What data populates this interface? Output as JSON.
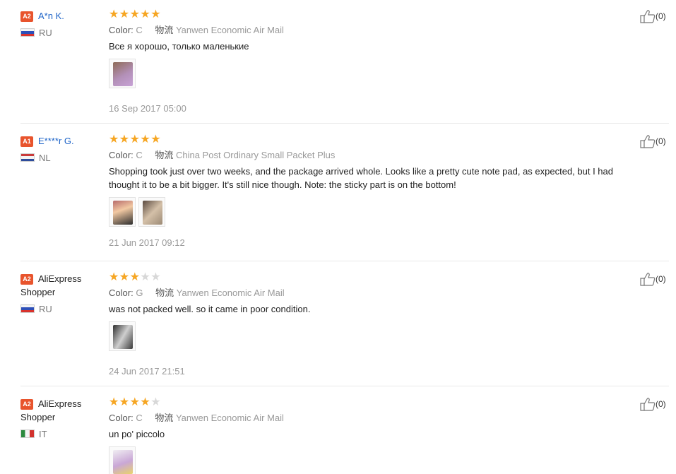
{
  "reviews": [
    {
      "badge": "A2",
      "user": "A*n K.",
      "user_is_link": true,
      "country": "RU",
      "flag": "ru",
      "rating": 5,
      "color_label": "Color:",
      "color_value": "C",
      "logistics_label": "物流",
      "logistics_value": "Yanwen Economic Air Mail",
      "text": "Все я хорошо, только маленькие",
      "photo_count": 1,
      "date": "16 Sep 2017 05:00",
      "helpful": "(0)"
    },
    {
      "badge": "A1",
      "user": "E****r G.",
      "user_is_link": true,
      "country": "NL",
      "flag": "nl",
      "rating": 5,
      "color_label": "Color:",
      "color_value": "C",
      "logistics_label": "物流",
      "logistics_value": "China Post Ordinary Small Packet Plus",
      "text": "Shopping took just over two weeks, and the package arrived whole. Looks like a pretty cute note pad, as expected, but I had thought it to be a bit bigger. It's still nice though. Note: the sticky part is on the bottom!",
      "photo_count": 2,
      "date": "21 Jun 2017 09:12",
      "helpful": "(0)"
    },
    {
      "badge": "A2",
      "user": "AliExpress Shopper",
      "user_is_link": false,
      "country": "RU",
      "flag": "ru",
      "rating": 3,
      "color_label": "Color:",
      "color_value": "G",
      "logistics_label": "物流",
      "logistics_value": "Yanwen Economic Air Mail",
      "text": "was not packed well. so it came in poor condition.",
      "photo_count": 1,
      "date": "24 Jun 2017 21:51",
      "helpful": "(0)"
    },
    {
      "badge": "A2",
      "user": "AliExpress Shopper",
      "user_is_link": false,
      "country": "IT",
      "flag": "it",
      "rating": 4,
      "color_label": "Color:",
      "color_value": "C",
      "logistics_label": "物流",
      "logistics_value": "Yanwen Economic Air Mail",
      "text": "un po' piccolo",
      "photo_count": 1,
      "date": "",
      "helpful": "(0)"
    }
  ],
  "colors": {
    "star": "#f6a623",
    "star_off": "#d8d8d8",
    "badge": "#e8542d",
    "link": "#1e64c8"
  },
  "icons": {
    "helpful": "thumbs-up-icon",
    "star": "star-icon"
  }
}
